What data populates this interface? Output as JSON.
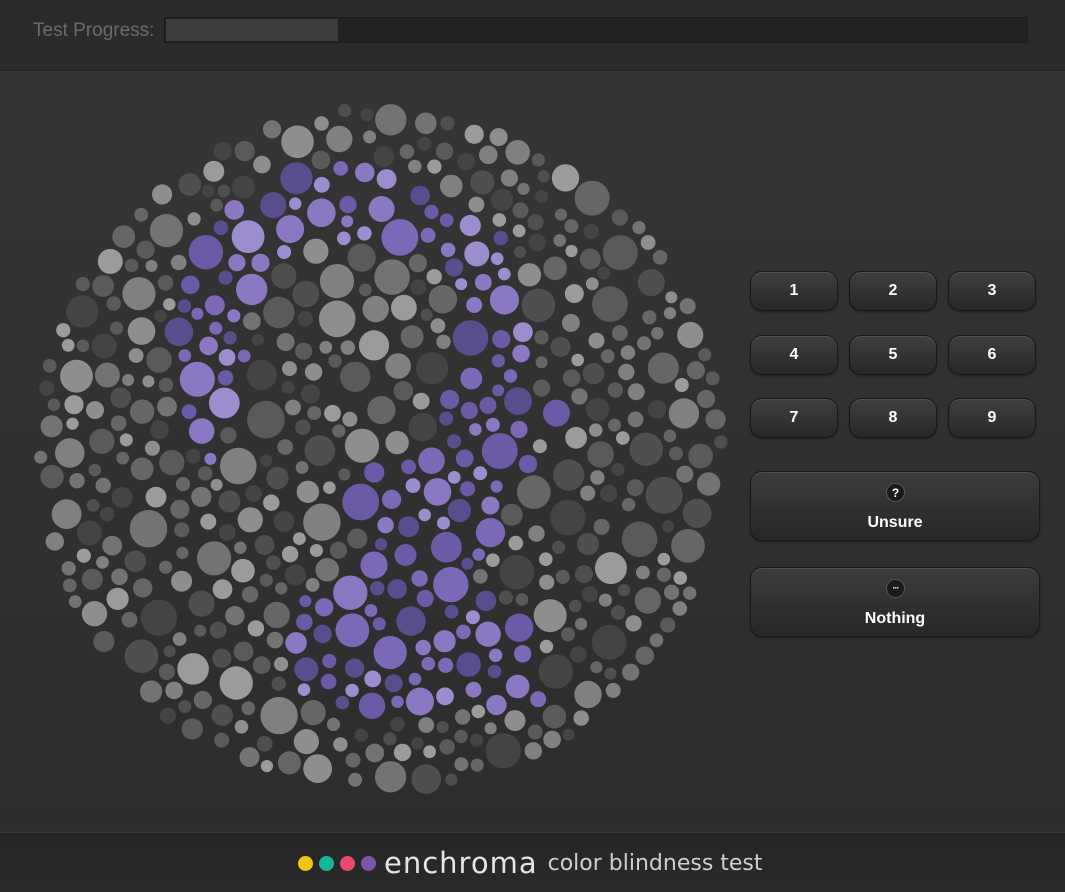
{
  "header": {
    "progress_label": "Test Progress:",
    "progress_fraction": 0.2
  },
  "plate": {
    "kind": "ishihara-style dot plate",
    "dot_colors": {
      "background": [
        "#444444",
        "#4f4f4f",
        "#5a5a5a",
        "#666666",
        "#737373",
        "#808080",
        "#8e8e8e",
        "#9b9b9b"
      ],
      "figure": [
        "#5a4d8e",
        "#6b5aa5",
        "#7b69b7",
        "#8a79c2",
        "#9c8dcf"
      ]
    }
  },
  "keypad": {
    "numbers": [
      "1",
      "2",
      "3",
      "4",
      "5",
      "6",
      "7",
      "8",
      "9"
    ],
    "unsure": {
      "icon": "question-icon",
      "glyph": "?",
      "label": "Unsure"
    },
    "nothing": {
      "icon": "ellipsis-icon",
      "glyph": "···",
      "label": "Nothing"
    }
  },
  "footer": {
    "brand_dots": [
      "#f2c40f",
      "#13b89a",
      "#e84a6d",
      "#7a55a8"
    ],
    "brand_name": "enchroma",
    "tagline": "color blindness test"
  }
}
